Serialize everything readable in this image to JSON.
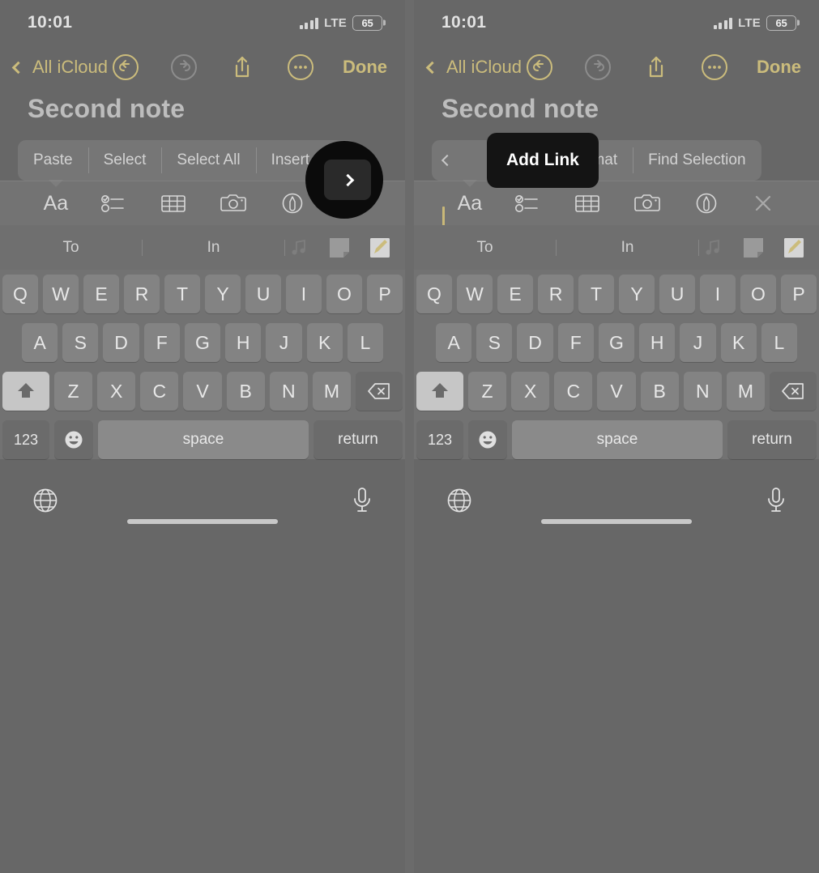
{
  "accent_color": "#cbbc7c",
  "background_color": "#676767",
  "panels": [
    {
      "id": "left",
      "status": {
        "time": "10:01",
        "network": "LTE",
        "battery": "65"
      },
      "nav": {
        "back_label": "All iCloud",
        "done_label": "Done",
        "icons": [
          "undo-icon",
          "redo-icon",
          "share-icon",
          "more-icon"
        ]
      },
      "note": {
        "title": "Second note"
      },
      "edit_menu": {
        "items": [
          "Paste",
          "Select",
          "Select All",
          "Insert"
        ],
        "forward_arrow": "chevron-right-icon",
        "highlight": "forward-arrow"
      }
    },
    {
      "id": "right",
      "status": {
        "time": "10:01",
        "network": "LTE",
        "battery": "65"
      },
      "nav": {
        "back_label": "All iCloud",
        "done_label": "Done",
        "icons": [
          "undo-icon",
          "redo-icon",
          "share-icon",
          "more-icon"
        ]
      },
      "note": {
        "title": "Second note"
      },
      "edit_menu": {
        "back_arrow": "chevron-left-icon",
        "items": [
          "Add Link",
          "Format",
          "Find Selection"
        ],
        "highlight": "Add Link"
      }
    }
  ],
  "format_toolbar": {
    "items": [
      {
        "name": "text-format-icon",
        "label": "Aa"
      },
      {
        "name": "checklist-icon",
        "label": ""
      },
      {
        "name": "table-icon",
        "label": ""
      },
      {
        "name": "camera-icon",
        "label": ""
      },
      {
        "name": "markup-icon",
        "label": ""
      },
      {
        "name": "close-icon",
        "label": ""
      }
    ]
  },
  "predictive_bar": {
    "suggestions": [
      "To",
      "In"
    ],
    "emoji_suggestions": [
      "music-note-sticker",
      "blank-note-sticker",
      "note-pencil-sticker"
    ]
  },
  "keyboard": {
    "row1": [
      "Q",
      "W",
      "E",
      "R",
      "T",
      "Y",
      "U",
      "I",
      "O",
      "P"
    ],
    "row2": [
      "A",
      "S",
      "D",
      "F",
      "G",
      "H",
      "J",
      "K",
      "L"
    ],
    "row3_letters": [
      "Z",
      "X",
      "C",
      "V",
      "B",
      "N",
      "M"
    ],
    "shift_key": "shift-icon",
    "backspace_key": "backspace-icon",
    "numbers_key": "123",
    "emoji_key": "emoji-icon",
    "space_key": "space",
    "return_key": "return",
    "globe_key": "globe-icon",
    "dictation_key": "microphone-icon"
  }
}
